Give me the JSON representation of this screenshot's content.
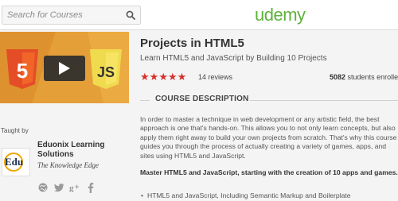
{
  "header": {
    "search_placeholder": "Search for Courses",
    "logo": "udemy",
    "brand_color": "#5fb23b"
  },
  "promo": {
    "html_badge": "5",
    "js_badge": "JS",
    "accent": "#e44d26"
  },
  "instructor": {
    "taught_by": "Taught by",
    "name": "Eduonix Learning Solutions",
    "tagline": "The Knowledge Edge",
    "avatar_text": "Edu",
    "socials": [
      "globe-icon",
      "twitter-icon",
      "google-plus-icon",
      "facebook-icon"
    ]
  },
  "course": {
    "title": "Projects in HTML5",
    "subtitle": "Learn HTML5 and JavaScript by Building 10 Projects",
    "rating_stars": 5,
    "star_color": "#d4322c",
    "reviews": "14 reviews",
    "students_count": "5082",
    "students_label": "students enrolled"
  },
  "description": {
    "heading": "COURSE DESCRIPTION",
    "paragraph": "In order to master a technique in web development or any artistic field, the best approach is one that's hands-on. This allows you to not only learn concepts, but also apply them right away to build your own projects from scratch. That's why this course guides you through the process of actually creating a variety of games, apps, and sites using HTML5 and JavaScript.",
    "bold_paragraph": "Master HTML5 and JavaScript, starting with the creation of 10 apps and games.",
    "bullets": [
      "HTML5 and JavaScript, Including Semantic Markup and Boilerplate"
    ]
  }
}
